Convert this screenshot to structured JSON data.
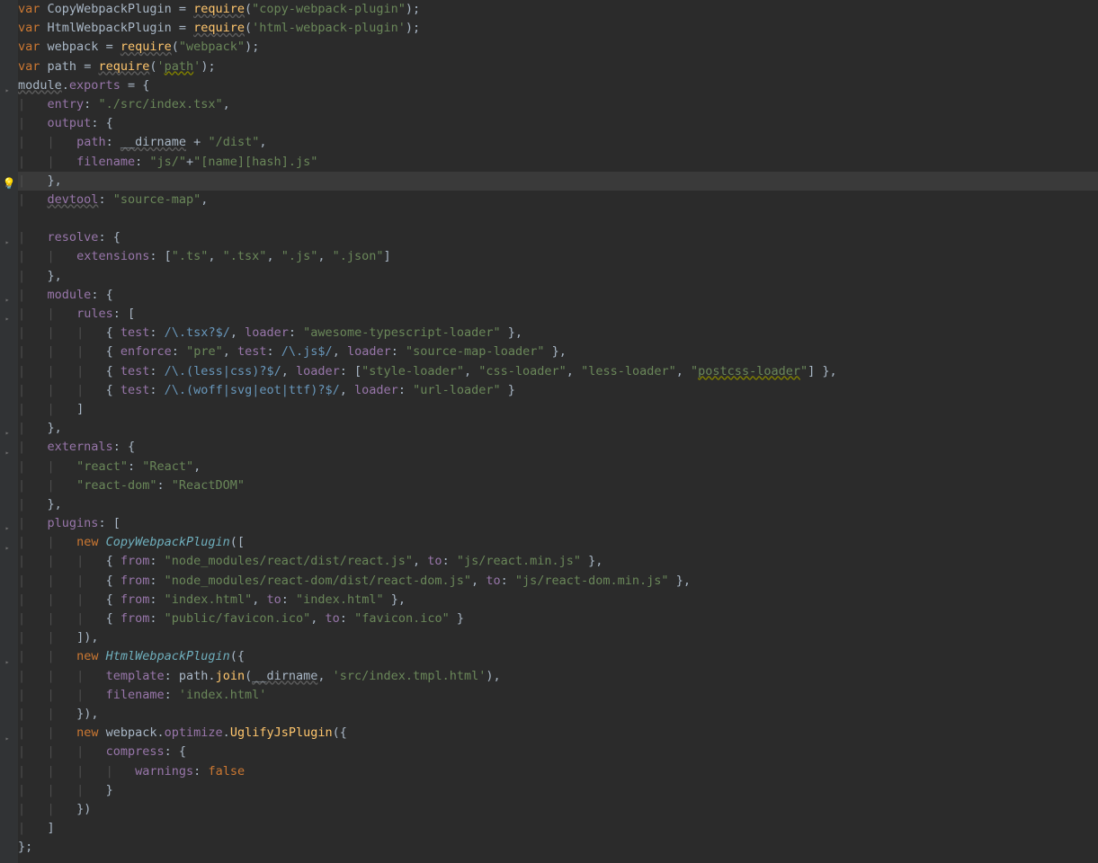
{
  "code": {
    "lines": [
      {
        "indent": 0,
        "html": "<span class='kw'>var</span> <span class='def'>CopyWebpackPlugin</span> <span class='punct'>=</span> <span class='fn underwave'>require</span><span class='punct'>(</span><span class='str'>\"copy-webpack-plugin\"</span><span class='punct'>);</span>"
      },
      {
        "indent": 0,
        "html": "<span class='kw'>var</span> <span class='def'>HtmlWebpackPlugin</span> <span class='punct'>=</span> <span class='fn underwave'>require</span><span class='punct'>(</span><span class='str'>'html-webpack-plugin'</span><span class='punct'>);</span>"
      },
      {
        "indent": 0,
        "html": "<span class='kw'>var</span> <span class='def'>webpack</span> <span class='punct'>=</span> <span class='fn underwave'>require</span><span class='punct'>(</span><span class='str'>\"webpack\"</span><span class='punct'>);</span>"
      },
      {
        "indent": 0,
        "html": "<span class='kw'>var</span> <span class='def'>path</span> <span class='punct'>=</span> <span class='fn underwave'>require</span><span class='punct'>(</span><span class='str'>'<span class='underwave-warn'>path</span>'</span><span class='punct'>);</span>"
      },
      {
        "indent": 0,
        "html": "<span class='glob underwave'>module</span><span class='punct'>.</span><span class='prop'>exports</span> <span class='punct'>= {</span>"
      },
      {
        "indent": 1,
        "html": "<span class='prop'>entry</span><span class='punct'>:</span> <span class='str'>\"./src/index.tsx\"</span><span class='punct'>,</span>"
      },
      {
        "indent": 1,
        "html": "<span class='prop'>output</span><span class='punct'>: {</span>"
      },
      {
        "indent": 2,
        "html": "<span class='prop'>path</span><span class='punct'>:</span> <span class='glob underwave'>__dirname</span> <span class='punct'>+</span> <span class='str'>\"/dist\"</span><span class='punct'>,</span>"
      },
      {
        "indent": 2,
        "html": "<span class='prop'>filename</span><span class='punct'>:</span> <span class='str'>\"js/\"</span><span class='punct'>+</span><span class='str'>\"[name][hash].js\"</span>"
      },
      {
        "indent": 1,
        "html": "<span class='punct'>},</span>",
        "hl": true,
        "bulb": true
      },
      {
        "indent": 1,
        "html": "<span class='prop underwave'>devtool</span><span class='punct'>:</span> <span class='str'>\"source-map\"</span><span class='punct'>,</span>"
      },
      {
        "indent": 0,
        "html": ""
      },
      {
        "indent": 1,
        "html": "<span class='prop'>resolve</span><span class='punct'>: {</span>"
      },
      {
        "indent": 2,
        "html": "<span class='prop'>extensions</span><span class='punct'>: [</span><span class='str'>\".ts\"</span><span class='punct'>,</span> <span class='str'>\".tsx\"</span><span class='punct'>,</span> <span class='str'>\".js\"</span><span class='punct'>,</span> <span class='str'>\".json\"</span><span class='punct'>]</span>"
      },
      {
        "indent": 1,
        "html": "<span class='punct'>},</span>"
      },
      {
        "indent": 1,
        "html": "<span class='prop'>module</span><span class='punct'>: {</span>"
      },
      {
        "indent": 2,
        "html": "<span class='prop'>rules</span><span class='punct'>: [</span>"
      },
      {
        "indent": 3,
        "html": "<span class='punct'>{</span> <span class='prop'>test</span><span class='punct'>:</span> <span class='regex'>/\\.tsx?$/</span><span class='punct'>,</span> <span class='prop'>loader</span><span class='punct'>:</span> <span class='str'>\"awesome-typescript-loader\"</span> <span class='punct'>},</span>"
      },
      {
        "indent": 3,
        "html": "<span class='punct'>{</span> <span class='prop'>enforce</span><span class='punct'>:</span> <span class='str'>\"pre\"</span><span class='punct'>,</span> <span class='prop'>test</span><span class='punct'>:</span> <span class='regex'>/\\.js$/</span><span class='punct'>,</span> <span class='prop'>loader</span><span class='punct'>:</span> <span class='str'>\"source-map-loader\"</span> <span class='punct'>},</span>"
      },
      {
        "indent": 3,
        "html": "<span class='punct'>{</span> <span class='prop'>test</span><span class='punct'>:</span> <span class='regex'>/\\.(less|css)?$/</span><span class='punct'>,</span> <span class='prop'>loader</span><span class='punct'>: [</span><span class='str'>\"style-loader\"</span><span class='punct'>,</span> <span class='str'>\"css-loader\"</span><span class='punct'>,</span> <span class='str'>\"less-loader\"</span><span class='punct'>,</span> <span class='str'>\"<span class='underwave-warn'>postcss-loader</span>\"</span><span class='punct'>] },</span>"
      },
      {
        "indent": 3,
        "html": "<span class='punct'>{</span> <span class='prop'>test</span><span class='punct'>:</span> <span class='regex'>/\\.(woff|svg|eot|ttf)?$/</span><span class='punct'>,</span> <span class='prop'>loader</span><span class='punct'>:</span> <span class='str'>\"url-loader\"</span> <span class='punct'>}</span>"
      },
      {
        "indent": 2,
        "html": "<span class='punct'>]</span>"
      },
      {
        "indent": 1,
        "html": "<span class='punct'>},</span>"
      },
      {
        "indent": 1,
        "html": "<span class='prop'>externals</span><span class='punct'>: {</span>"
      },
      {
        "indent": 2,
        "html": "<span class='str'>\"react\"</span><span class='punct'>:</span> <span class='str'>\"React\"</span><span class='punct'>,</span>"
      },
      {
        "indent": 2,
        "html": "<span class='str'>\"react-dom\"</span><span class='punct'>:</span> <span class='str'>\"ReactDOM\"</span>"
      },
      {
        "indent": 1,
        "html": "<span class='punct'>},</span>"
      },
      {
        "indent": 1,
        "html": "<span class='prop'>plugins</span><span class='punct'>: [</span>"
      },
      {
        "indent": 2,
        "html": "<span class='kw'>new</span> <span class='cls'>CopyWebpackPlugin</span><span class='punct'>([</span>"
      },
      {
        "indent": 3,
        "html": "<span class='punct'>{</span> <span class='prop'>from</span><span class='punct'>:</span> <span class='str'>\"node_modules/react/dist/react.js\"</span><span class='punct'>,</span> <span class='prop'>to</span><span class='punct'>:</span> <span class='str'>\"js/react.min.js\"</span> <span class='punct'>},</span>"
      },
      {
        "indent": 3,
        "html": "<span class='punct'>{</span> <span class='prop'>from</span><span class='punct'>:</span> <span class='str'>\"node_modules/react-dom/dist/react-dom.js\"</span><span class='punct'>,</span> <span class='prop'>to</span><span class='punct'>:</span> <span class='str'>\"js/react-dom.min.js\"</span> <span class='punct'>},</span>"
      },
      {
        "indent": 3,
        "html": "<span class='punct'>{</span> <span class='prop'>from</span><span class='punct'>:</span> <span class='str'>\"index.html\"</span><span class='punct'>,</span> <span class='prop'>to</span><span class='punct'>:</span> <span class='str'>\"index.html\"</span> <span class='punct'>},</span>"
      },
      {
        "indent": 3,
        "html": "<span class='punct'>{</span> <span class='prop'>from</span><span class='punct'>:</span> <span class='str'>\"public/favicon.ico\"</span><span class='punct'>,</span> <span class='prop'>to</span><span class='punct'>:</span> <span class='str'>\"favicon.ico\"</span> <span class='punct'>}</span>"
      },
      {
        "indent": 2,
        "html": "<span class='punct'>]),</span>"
      },
      {
        "indent": 2,
        "html": "<span class='kw'>new</span> <span class='cls'>HtmlWebpackPlugin</span><span class='punct'>({</span>"
      },
      {
        "indent": 3,
        "html": "<span class='prop'>template</span><span class='punct'>:</span> <span class='def'>path</span><span class='punct'>.</span><span class='fn'>join</span><span class='punct'>(</span><span class='glob underwave'>__dirname</span><span class='punct'>,</span> <span class='str'>'src/index.tmpl.html'</span><span class='punct'>),</span>"
      },
      {
        "indent": 3,
        "html": "<span class='prop'>filename</span><span class='punct'>:</span> <span class='str'>'index.html'</span>"
      },
      {
        "indent": 2,
        "html": "<span class='punct'>}),</span>"
      },
      {
        "indent": 2,
        "html": "<span class='kw'>new</span> <span class='def'>webpack</span><span class='punct'>.</span><span class='prop'>optimize</span><span class='punct'>.</span><span class='fn'>UglifyJsPlugin</span><span class='punct'>({</span>"
      },
      {
        "indent": 3,
        "html": "<span class='prop'>compress</span><span class='punct'>: {</span>"
      },
      {
        "indent": 4,
        "html": "<span class='prop'>warnings</span><span class='punct'>:</span> <span class='bool'>false</span>"
      },
      {
        "indent": 3,
        "html": "<span class='punct'>}</span>"
      },
      {
        "indent": 2,
        "html": "<span class='punct'>})</span>"
      },
      {
        "indent": 1,
        "html": "<span class='punct'>]</span>"
      },
      {
        "indent": 0,
        "html": "<span class='punct'>};</span>"
      }
    ]
  },
  "gutter_marks": [
    {
      "line": 9,
      "type": "bulb"
    },
    {
      "line": 10,
      "type": "fold"
    },
    {
      "line": 12,
      "type": "fold"
    },
    {
      "line": 16,
      "type": "fold"
    },
    {
      "line": 17,
      "type": "fold"
    },
    {
      "line": 22,
      "type": "fold"
    },
    {
      "line": 23,
      "type": "fold"
    }
  ]
}
